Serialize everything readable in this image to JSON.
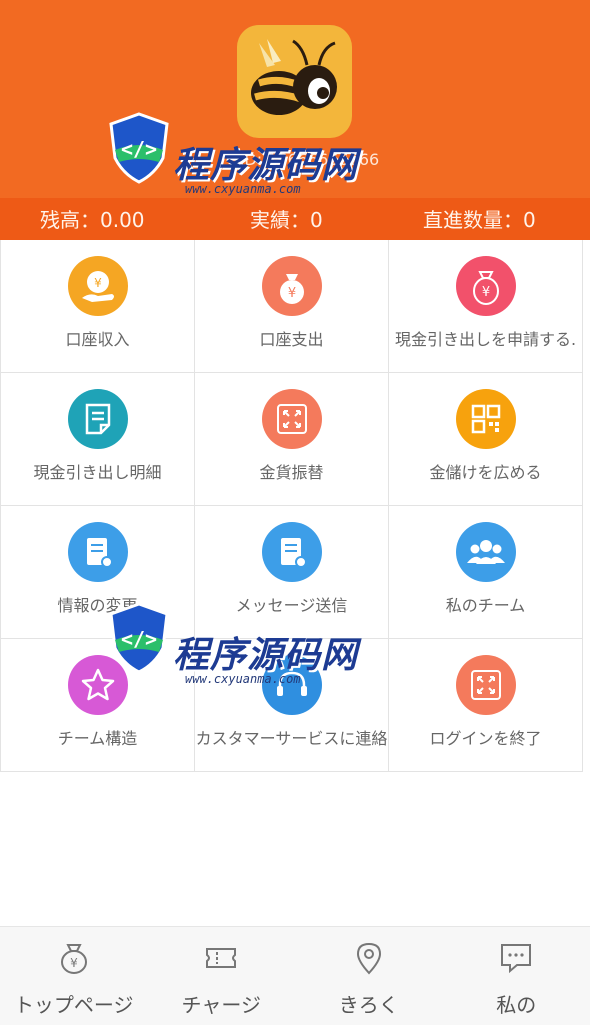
{
  "profile": {
    "uid": "UID: 16666666666"
  },
  "stats": {
    "balance": "残高：0.00",
    "performance": "実績：0",
    "direct_count": "直進数量：0"
  },
  "menu": [
    {
      "label": "口座収入",
      "icon": "money-hand-icon",
      "color": "#f5a623"
    },
    {
      "label": "口座支出",
      "icon": "money-bag-icon",
      "color": "#f47a5c"
    },
    {
      "label": "現金引き出しを申請する.",
      "icon": "money-bag-icon",
      "color": "#f2516b"
    },
    {
      "label": "現金引き出し明細",
      "icon": "document-icon",
      "color": "#1fa3b7"
    },
    {
      "label": "金貨振替",
      "icon": "expand-icon",
      "color": "#f47a5c"
    },
    {
      "label": "金儲けを広める",
      "icon": "qrcode-icon",
      "color": "#f7a20d"
    },
    {
      "label": "情報の変更",
      "icon": "form-icon",
      "color": "#3d9ee8"
    },
    {
      "label": "メッセージ送信",
      "icon": "form-icon",
      "color": "#3d9ee8"
    },
    {
      "label": "私のチーム",
      "icon": "team-icon",
      "color": "#3d9ee8"
    },
    {
      "label": "チーム構造",
      "icon": "star-icon",
      "color": "#d759d6"
    },
    {
      "label": "カスタマーサービスに連絡",
      "icon": "headset-icon",
      "color": "#2f8fe0"
    },
    {
      "label": "ログインを終了",
      "icon": "expand-icon",
      "color": "#f47a5c"
    }
  ],
  "tabs": [
    {
      "label": "トップページ",
      "icon": "money-bag-icon"
    },
    {
      "label": "チャージ",
      "icon": "ticket-icon"
    },
    {
      "label": "きろく",
      "icon": "location-pin-icon"
    },
    {
      "label": "私の",
      "icon": "chat-icon"
    }
  ],
  "watermark": {
    "title": "程序源码网",
    "url": "www.cxyuanma.com"
  }
}
